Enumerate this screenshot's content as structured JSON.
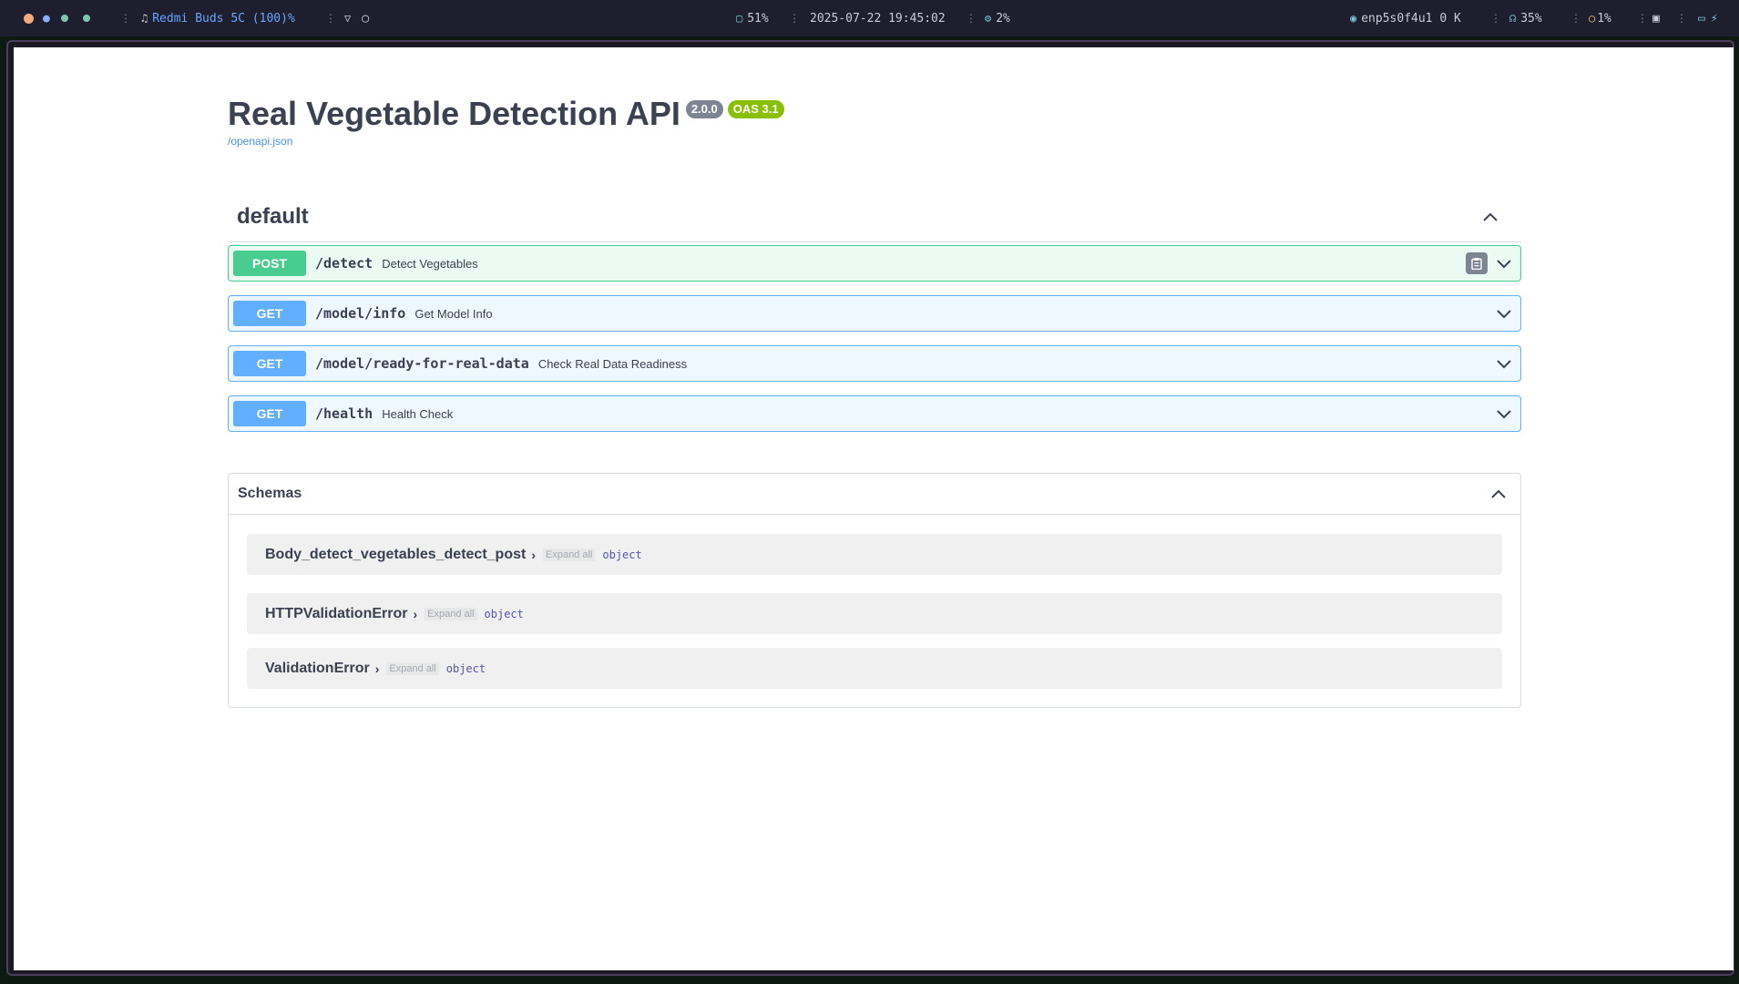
{
  "statusbar": {
    "headset_label": "Redmi Buds 5C (100)%",
    "disk": "51%",
    "datetime": "2025-07-22 19:45:02",
    "cpu": "2%",
    "network": "enp5s0f4u1 0 K",
    "volume": "35%",
    "brightness": "1%",
    "colors": {
      "headset": "#6aa7ff",
      "accent": "#7cc7d8"
    }
  },
  "api": {
    "title": "Real Vegetable Detection API",
    "version": "2.0.0",
    "oas": "OAS 3.1",
    "spec_link": "/openapi.json"
  },
  "section": {
    "title": "default"
  },
  "operations": [
    {
      "method": "POST",
      "path": "/detect",
      "summary": "Detect Vegetables"
    },
    {
      "method": "GET",
      "path": "/model/info",
      "summary": "Get Model Info"
    },
    {
      "method": "GET",
      "path": "/model/ready-for-real-data",
      "summary": "Check Real Data Readiness"
    },
    {
      "method": "GET",
      "path": "/health",
      "summary": "Health Check"
    }
  ],
  "schemas": {
    "title": "Schemas",
    "expand_all": "Expand all",
    "models": [
      {
        "name": "Body_detect_vegetables_detect_post",
        "type": "object"
      },
      {
        "name": "HTTPValidationError",
        "type": "object"
      },
      {
        "name": "ValidationError",
        "type": "object"
      }
    ]
  }
}
